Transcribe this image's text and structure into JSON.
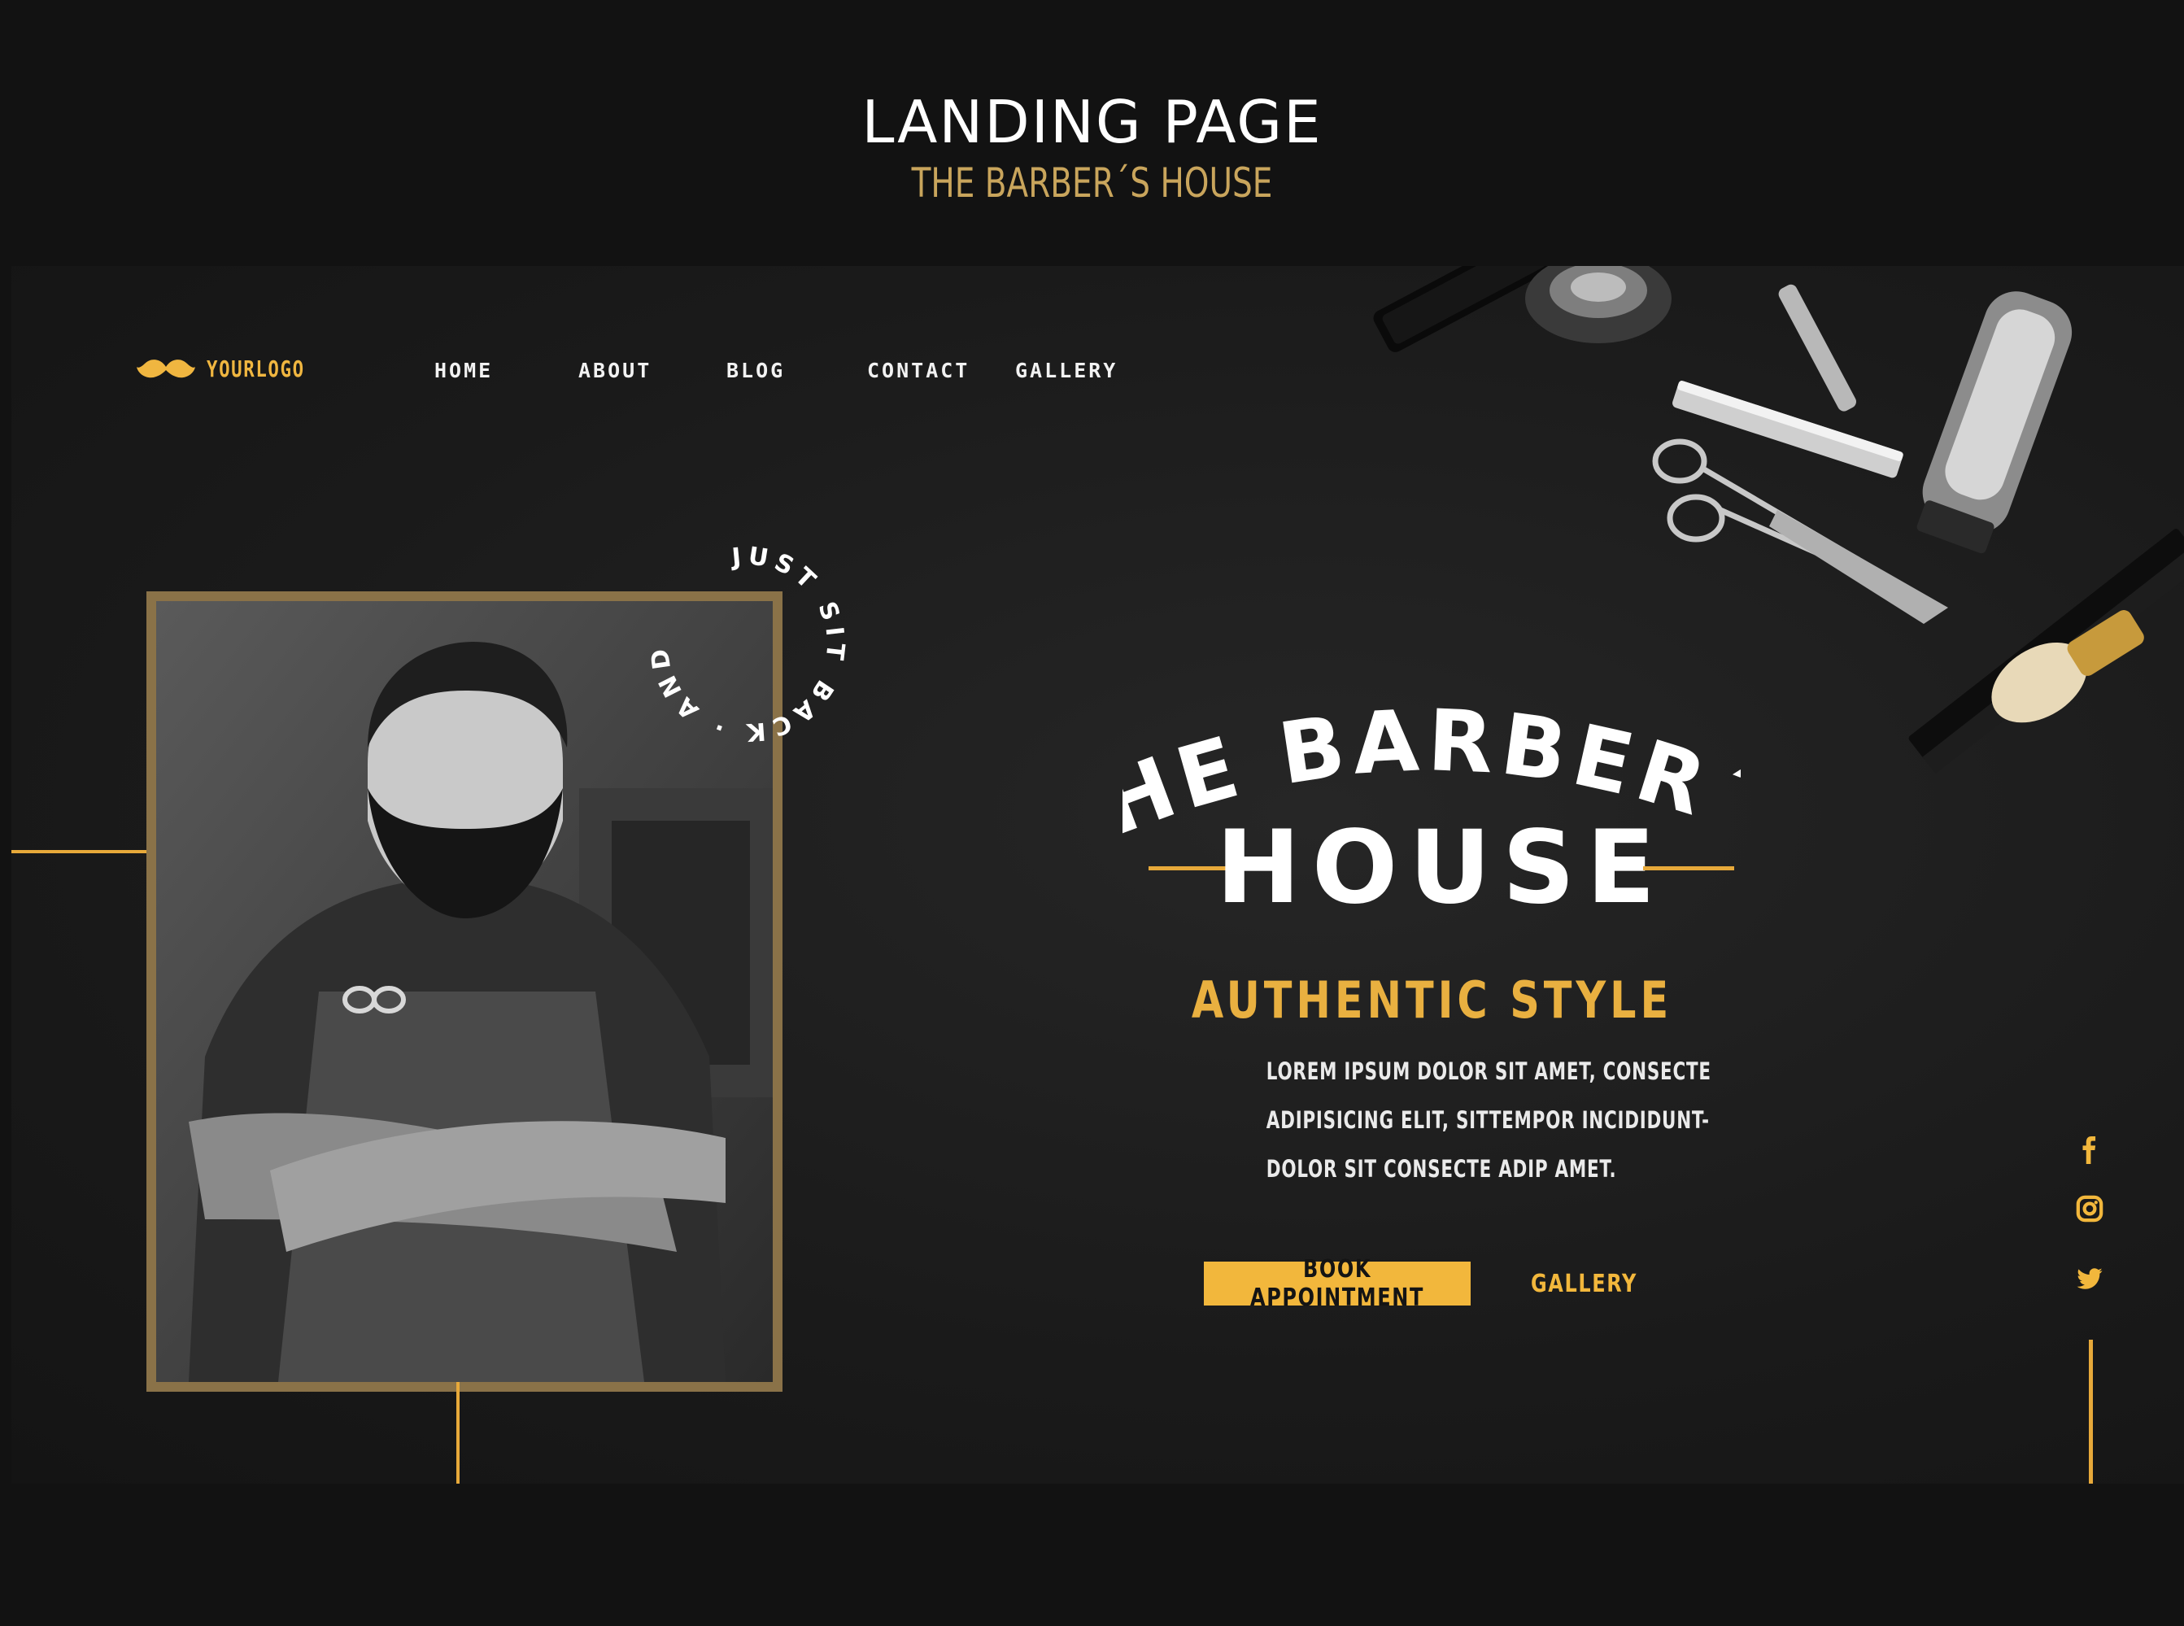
{
  "showcase": {
    "title": "LANDING PAGE",
    "subtitle": "THE BARBER´S HOUSE"
  },
  "nav": {
    "logo_icon": "mustache-icon",
    "logo_text": "YOURLOGO",
    "items": [
      {
        "label": "HOME"
      },
      {
        "label": "ABOUT"
      },
      {
        "label": "BLOG"
      },
      {
        "label": "CONTACT"
      },
      {
        "label": "GALLERY"
      }
    ]
  },
  "badge": {
    "text": "JUST SIT BACK · AND ENJOY ·"
  },
  "hero": {
    "title_line1": "THE BARBER´S",
    "title_line2": "HOUSE",
    "tagline": "AUTHENTIC STYLE",
    "description": [
      "LOREM IPSUM DOLOR SIT AMET, CONSECTE",
      "ADIPISICING ELIT, SITTEMPOR INCIDIDUNT-",
      "DOLOR SIT CONSECTE ADIP AMET."
    ],
    "primary_button": "BOOK APPOINTMENT",
    "secondary_button": "GALLERY"
  },
  "social": [
    {
      "icon": "facebook-icon"
    },
    {
      "icon": "instagram-icon"
    },
    {
      "icon": "twitter-icon"
    }
  ],
  "colors": {
    "accent": "#f2b73c",
    "frame": "#8a7248",
    "background": "#121212",
    "subtitle_gold": "#c9a55c"
  }
}
